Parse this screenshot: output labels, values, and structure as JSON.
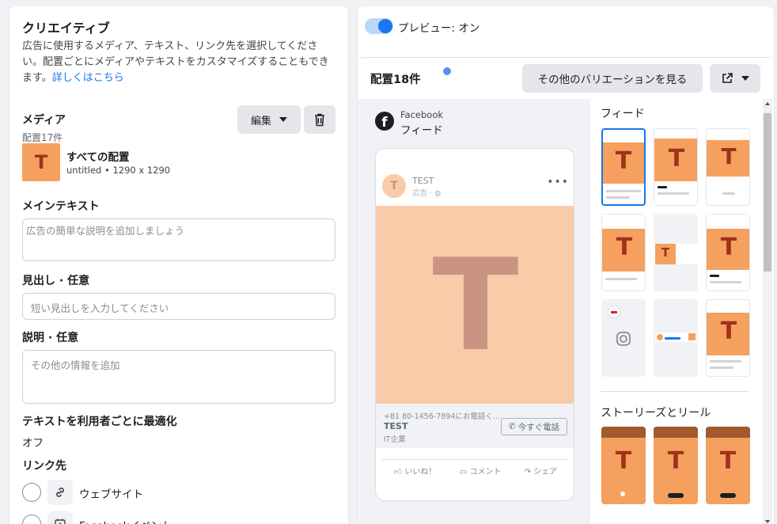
{
  "creative": {
    "title": "クリエイティブ",
    "description": "広告に使用するメディア、テキスト、リンク先を選択してください。配置ごとにメディアやテキストをカスタマイズすることもできます。",
    "learn_more": "詳しくはこちら"
  },
  "media": {
    "label": "メディア",
    "count": "配置17件",
    "edit_label": "編集",
    "item_title": "すべての配置",
    "item_meta": "untitled • 1290 x 1290",
    "thumb_letter": "T"
  },
  "main_text": {
    "label": "メインテキスト",
    "placeholder": "広告の簡単な説明を追加しましょう"
  },
  "headline": {
    "label": "見出し · 任意",
    "placeholder": "短い見出しを入力してください"
  },
  "description_field": {
    "label": "説明 · 任意",
    "placeholder": "その他の情報を追加"
  },
  "optimize": {
    "label": "テキストを利用者ごとに最適化",
    "value": "オフ"
  },
  "destination": {
    "label": "リンク先",
    "options": [
      {
        "label": "ウェブサイト",
        "icon": "link-icon"
      },
      {
        "label": "Facebookイベント",
        "icon": "event-icon"
      }
    ]
  },
  "preview": {
    "toggle_label": "プレビュー: オン",
    "placements": "配置18件",
    "variations_button": "その他のバリエーションを見る",
    "platform": "Facebook",
    "placement": "フィード",
    "ad": {
      "page_name": "TEST",
      "sponsored": "広告 · ",
      "letter": "T",
      "link_caption": "+81 80-1456-7894にお電話く...",
      "link_title": "TEST",
      "link_sub": "IT企業",
      "cta": "今すぐ電話",
      "like": "いいね！",
      "comment": "コメント",
      "share": "シェア"
    }
  },
  "grid": {
    "feed_title": "フィード",
    "stories_title": "ストーリーズとリール",
    "letter": "T"
  },
  "colors": {
    "accent": "#1877f2",
    "orange": "#f5a05f",
    "letter": "#a0321c",
    "preview_bg": "#f9cba8",
    "preview_letter": "#c99582"
  }
}
